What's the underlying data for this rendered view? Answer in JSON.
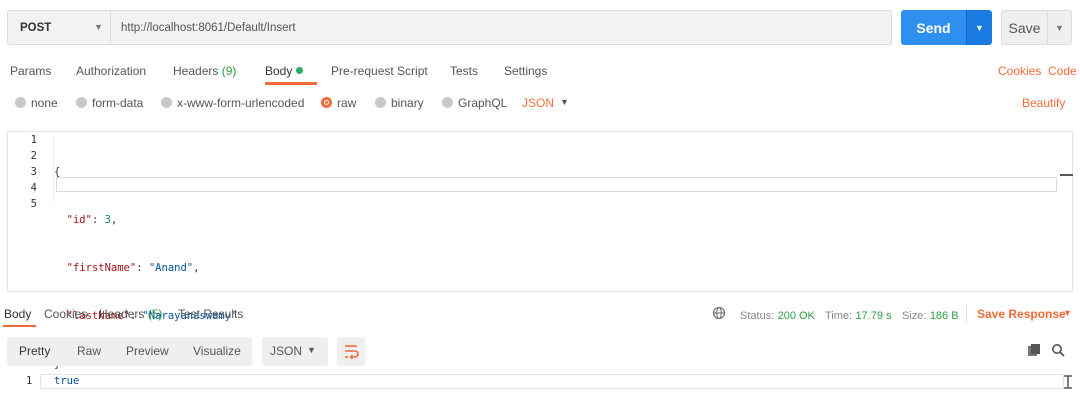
{
  "request": {
    "method": "POST",
    "url": "http://localhost:8061/Default/Insert",
    "send_label": "Send",
    "save_label": "Save"
  },
  "request_tabs": [
    {
      "label": "Params"
    },
    {
      "label": "Authorization"
    },
    {
      "label": "Headers",
      "count": "(9)"
    },
    {
      "label": "Body",
      "active": true
    },
    {
      "label": "Pre-request Script"
    },
    {
      "label": "Tests"
    },
    {
      "label": "Settings"
    }
  ],
  "links": {
    "cookies": "Cookies",
    "code": "Code",
    "beautify": "Beautify"
  },
  "body_types": [
    {
      "label": "none"
    },
    {
      "label": "form-data"
    },
    {
      "label": "x-www-form-urlencoded"
    },
    {
      "label": "raw",
      "selected": true
    },
    {
      "label": "binary"
    },
    {
      "label": "GraphQL"
    }
  ],
  "body_format": "JSON",
  "editor": {
    "line_numbers": [
      "1",
      "2",
      "3",
      "4",
      "5"
    ],
    "lines": [
      {
        "open": "{"
      },
      {
        "key": "\"id\"",
        "sep": ": ",
        "num": "3",
        "end": ","
      },
      {
        "key": "\"firstName\"",
        "sep": ": ",
        "str": "\"Anand\"",
        "end": ","
      },
      {
        "key": "\"lastName\"",
        "sep": ": ",
        "str": "\"Narayanaswamy\"",
        "end": ""
      },
      {
        "close": "}"
      }
    ]
  },
  "response_tabs": [
    {
      "label": "Body",
      "active": true
    },
    {
      "label": "Cookies"
    },
    {
      "label": "Headers",
      "count": "(5)"
    },
    {
      "label": "Test Results"
    }
  ],
  "response_meta": {
    "status_label": "Status:",
    "status_value": "200 OK",
    "time_label": "Time:",
    "time_value": "17.79 s",
    "size_label": "Size:",
    "size_value": "186 B",
    "save_response": "Save Response"
  },
  "response_view": {
    "modes": [
      "Pretty",
      "Raw",
      "Preview",
      "Visualize"
    ],
    "format": "JSON",
    "line_number": "1",
    "content": "true"
  },
  "icons": [
    "caret-down-icon",
    "globe-icon",
    "copy-icon",
    "search-icon",
    "wrap-lines-icon"
  ],
  "colors": {
    "accent": "#f26b3a",
    "send": "#2e8ff0",
    "success": "#2f9e44"
  }
}
